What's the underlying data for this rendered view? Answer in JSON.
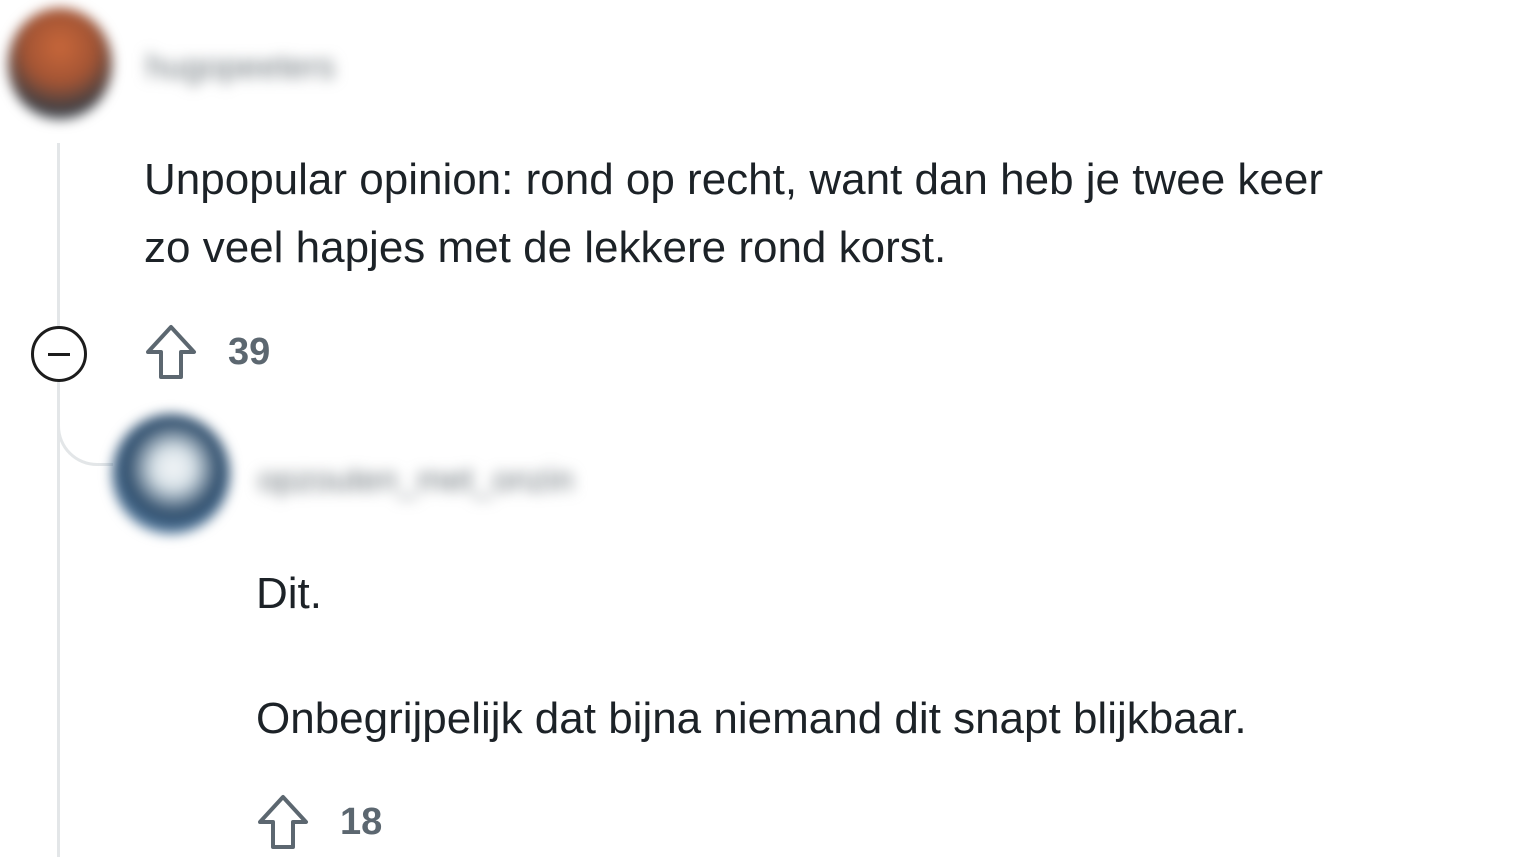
{
  "comment": {
    "username": "hugopeeters",
    "body": "Unpopular opinion: rond op recht, want dan heb je twee keer zo veel hapjes met de lekkere rond korst.",
    "body_line1": "Unpopular opinion: rond op recht, want dan heb je twee keer",
    "body_line2": "zo veel hapjes met de lekkere rond korst.",
    "upvotes": "39",
    "reply": {
      "username": "opzouten_met_onzin",
      "body_line1": "Dit.",
      "body_line2": "Onbegrijpelijk dat bijna niemand dit snapt blijkbaar.",
      "upvotes": "18"
    }
  },
  "icons": {
    "collapse": "minus-circle-icon",
    "upvote": "arrow-up-outline-icon"
  },
  "colors": {
    "text": "#1c2227",
    "meta": "#5c6770",
    "thread_line": "#e3e6e8"
  }
}
